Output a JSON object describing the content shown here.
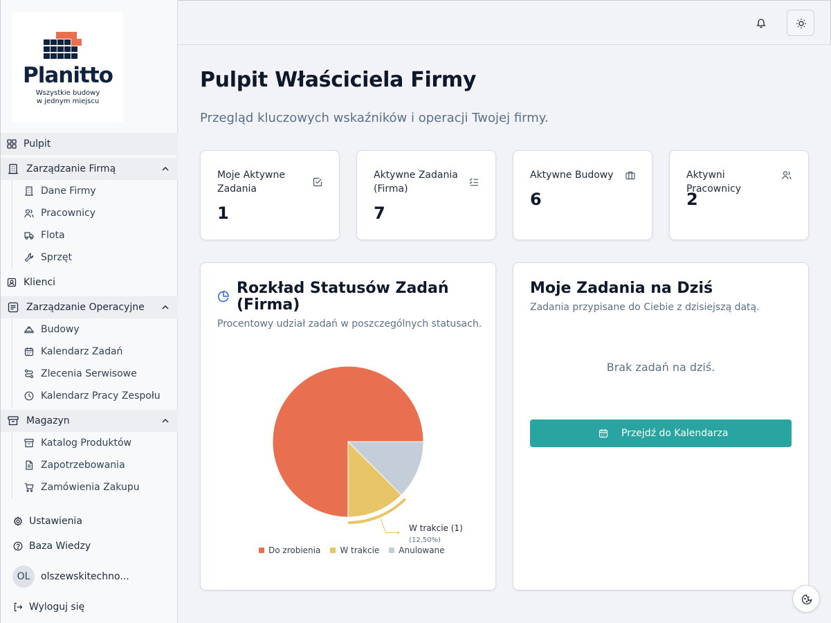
{
  "brand": {
    "name": "Planitto",
    "tagline_1": "Wszystkie budowy",
    "tagline_2": "w jednym miejscu"
  },
  "sidebar": {
    "pulpit": "Pulpit",
    "group_firm": {
      "label": "Zarządzanie Firmą",
      "items": [
        "Dane Firmy",
        "Pracownicy",
        "Flota",
        "Sprzęt"
      ]
    },
    "klienci": "Klienci",
    "group_ops": {
      "label": "Zarządzanie Operacyjne",
      "items": [
        "Budowy",
        "Kalendarz Zadań",
        "Zlecenia Serwisowe",
        "Kalendarz Pracy Zespołu"
      ]
    },
    "group_mag": {
      "label": "Magazyn",
      "items": [
        "Katalog Produktów",
        "Zapotrzebowania",
        "Zamówienia Zakupu"
      ]
    },
    "settings": "Ustawienia",
    "knowledge": "Baza Wiedzy",
    "user_initials": "OL",
    "user_name": "olszewskitechno...",
    "logout": "Wyloguj się"
  },
  "main": {
    "title": "Pulpit Właściciela Firmy",
    "subtitle": "Przegląd kluczowych wskaźników i operacji Twojej firmy.",
    "stats": [
      {
        "label": "Moje Aktywne Zadania",
        "value": "1",
        "icon": "check-square-icon"
      },
      {
        "label": "Aktywne Zadania (Firma)",
        "value": "7",
        "icon": "list-checks-icon"
      },
      {
        "label": "Aktywne Budowy",
        "value": "6",
        "icon": "briefcase-icon"
      },
      {
        "label": "Aktywni Pracownicy",
        "value": "2",
        "icon": "users-icon"
      }
    ],
    "pie_card": {
      "title": "Rozkład Statusów Zadań (Firma)",
      "description": "Procentowy udział zadań w poszczególnych statusach."
    },
    "today_card": {
      "title": "Moje Zadania na Dziś",
      "description": "Zadania przypisane do Ciebie z dzisiejszą datą.",
      "empty": "Brak zadań na dziś.",
      "button": "Przejdź do Kalendarza"
    }
  },
  "chart_data": {
    "type": "pie",
    "categories": [
      "Do zrobienia",
      "W trakcie",
      "Anulowane"
    ],
    "values": [
      75,
      12.5,
      12.5
    ],
    "colors": [
      "#e86f50",
      "#e8c566",
      "#c5ced8"
    ],
    "hover_label": "W trakcie (1)",
    "hover_pct": "(12,50%)",
    "legend": "bottom"
  },
  "colors": {
    "accent": "#2aa4a1",
    "text_muted": "#5b7088"
  }
}
